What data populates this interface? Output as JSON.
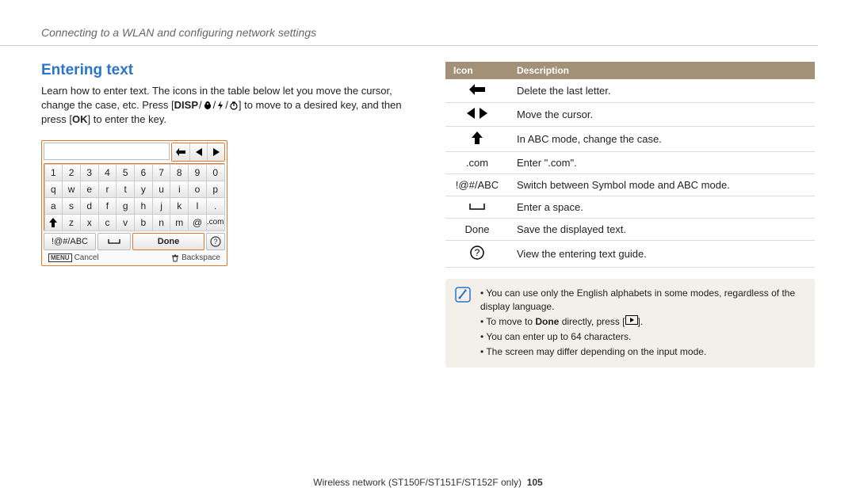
{
  "header": {
    "breadcrumb": "Connecting to a WLAN and configuring network settings"
  },
  "section": {
    "title": "Entering text",
    "intro_part1": "Learn how to enter text. The icons in the table below let you move the cursor, change the case, etc. Press [",
    "intro_disp": "DISP",
    "intro_part2": "] to move to a desired key, and then press [",
    "intro_ok": "OK",
    "intro_part3": "] to enter the key."
  },
  "keyboard": {
    "rows": [
      [
        "1",
        "2",
        "3",
        "4",
        "5",
        "6",
        "7",
        "8",
        "9",
        "0"
      ],
      [
        "q",
        "w",
        "e",
        "r",
        "t",
        "y",
        "u",
        "i",
        "o",
        "p"
      ],
      [
        "a",
        "s",
        "d",
        "f",
        "g",
        "h",
        "j",
        "k",
        "l",
        "."
      ],
      [
        "⬆",
        "z",
        "x",
        "c",
        "v",
        "b",
        "n",
        "m",
        "@",
        ".com"
      ]
    ],
    "mode_label": "!@#/ABC",
    "space_glyph": "␣",
    "done_label": "Done",
    "help_glyph": "?",
    "footer_cancel": "Cancel",
    "footer_menu": "MENU",
    "footer_backspace": "Backspace"
  },
  "table": {
    "head_icon": "Icon",
    "head_desc": "Description",
    "rows": [
      {
        "icon_type": "back-arrow",
        "desc": "Delete the last letter."
      },
      {
        "icon_type": "lr-arrows",
        "desc": "Move the cursor."
      },
      {
        "icon_type": "up-arrow",
        "desc": "In ABC mode, change the case."
      },
      {
        "icon_type": "com-text",
        "icon_text": ".com",
        "desc": "Enter \".com\"."
      },
      {
        "icon_type": "mode-text",
        "icon_text": "!@#/ABC",
        "desc": "Switch between Symbol mode and ABC mode."
      },
      {
        "icon_type": "space-glyph",
        "desc": "Enter a space."
      },
      {
        "icon_type": "done-text",
        "icon_text": "Done",
        "desc": "Save the displayed text."
      },
      {
        "icon_type": "help-circle",
        "desc": "View the entering text guide."
      }
    ]
  },
  "notes": {
    "line1": "You can use only the English alphabets in some modes, regardless of the display language.",
    "line2a": "To move to ",
    "line2b": "Done",
    "line2c": " directly, press [",
    "line2d": "].",
    "line3": "You can enter up to 64 characters.",
    "line4": "The screen may differ depending on the input mode."
  },
  "footer": {
    "text": "Wireless network  (ST150F/ST151F/ST152F only)",
    "page": "105"
  }
}
